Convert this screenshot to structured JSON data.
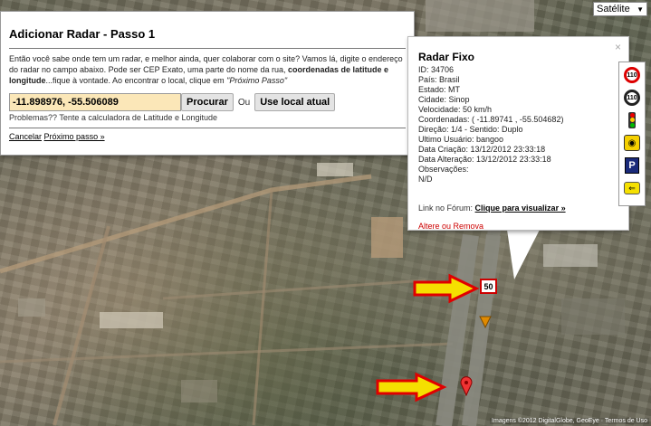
{
  "map": {
    "type_label": "Satélite",
    "copyright": "Imagens ©2012 DigitalGlobe, GeoEye · Termos de Uso"
  },
  "dialog": {
    "title": "Adicionar Radar - Passo 1",
    "desc_part1": "Então você sabe onde tem um radar, e melhor ainda, quer colaborar com o site? Vamos lá, digite o endereço do radar no campo abaixo. Pode ser CEP Exato, uma parte do nome da rua, ",
    "desc_bold": "coordenadas de latitude e longitude",
    "desc_part2": "...fique à vontade. Ao encontrar o local, clique em ",
    "desc_italic": "\"Próximo Passo\"",
    "coord_value": "-11.898976, -55.506089",
    "search_label": "Procurar",
    "or_label": "Ou",
    "use_location_label": "Use local atual",
    "problems_text": "Problemas?? Tente a calculadora de Latitude e Longitude",
    "cancel_label": "Cancelar",
    "next_label": "Próximo passo »"
  },
  "info": {
    "title": "Radar Fixo",
    "lines": [
      "ID: 34706",
      "País: Brasil",
      "Estado: MT",
      "Cidade: Sinop",
      "Velocidade: 50 km/h",
      "Coordenadas: ( -11.89741 , -55.504682)",
      "Direção: 1/4 - Sentido: Duplo",
      "Ultimo Usuário: bangoo",
      "Data Criação: 13/12/2012 23:33:18",
      "Data Alteração: 13/12/2012 23:33:18",
      "Observações:",
      "N/D"
    ],
    "forum_prefix": "Link no Fórum: ",
    "forum_link": "Clique para visualizar »",
    "edit_text": "Altere ou Remova",
    "close_glyph": "×"
  },
  "toolbar": {
    "speed1": "110",
    "speed2": "110"
  },
  "marker": {
    "speed": "50"
  },
  "colors": {
    "arrow_fill": "#f5e000",
    "arrow_stroke": "#e00000",
    "input_bg": "#fbe7b8"
  }
}
